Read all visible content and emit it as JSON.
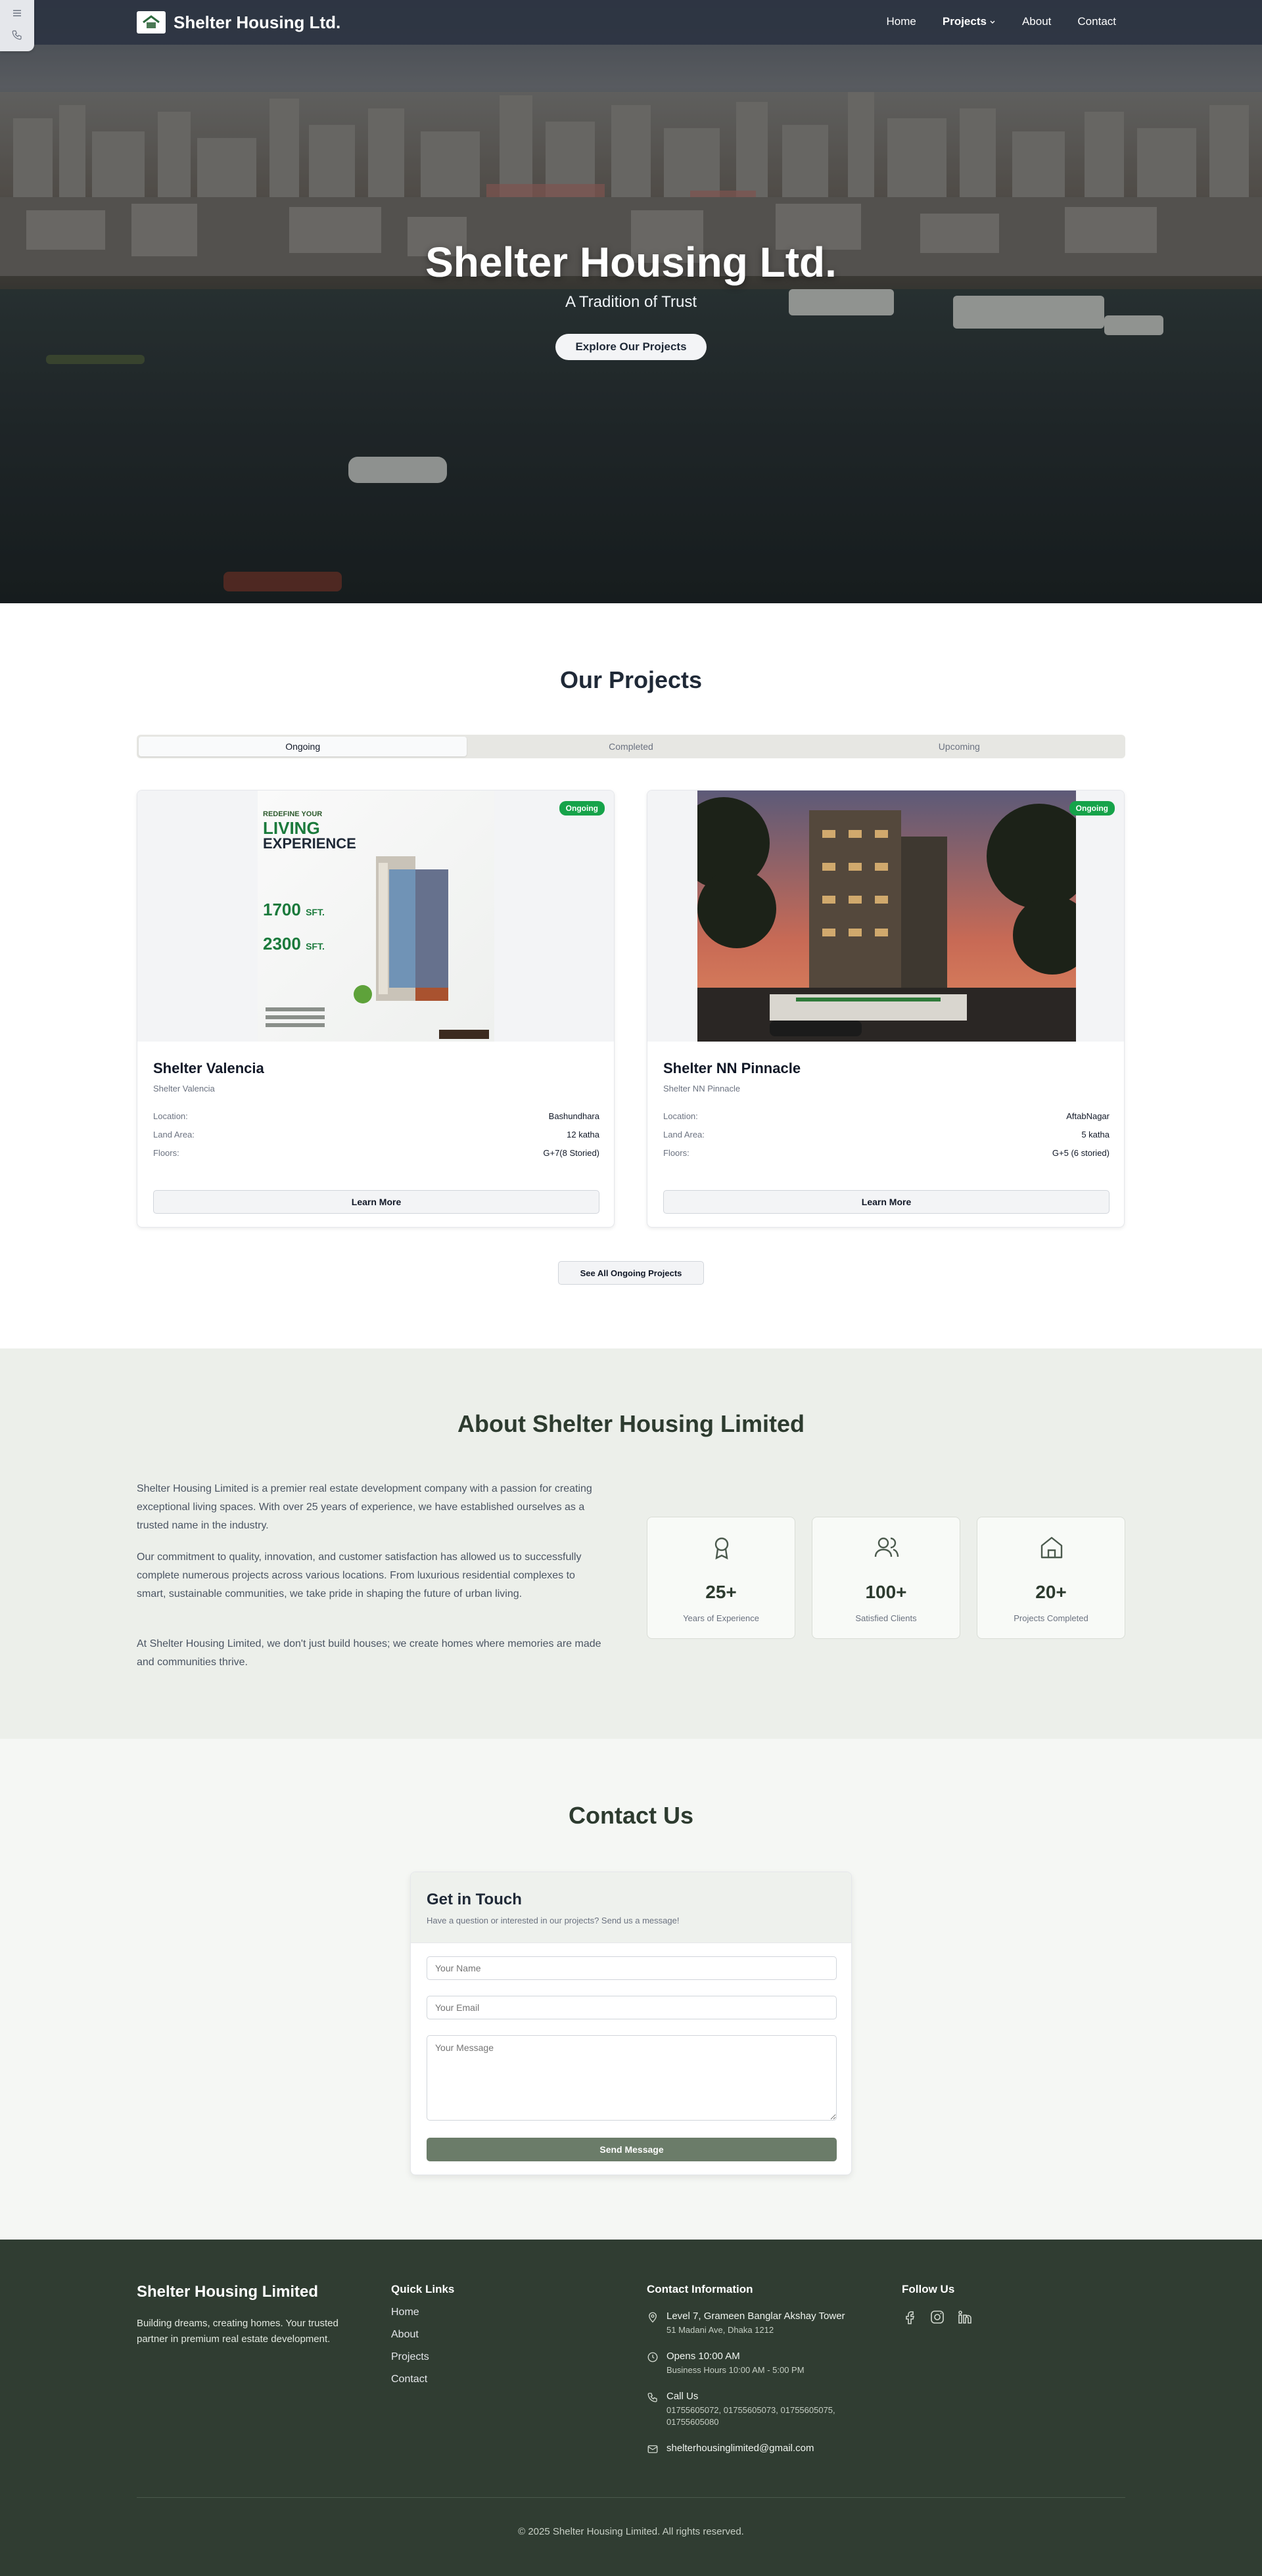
{
  "header": {
    "brand": "Shelter Housing Ltd.",
    "nav": [
      "Home",
      "Projects",
      "About",
      "Contact"
    ],
    "active_nav": "Projects"
  },
  "hero": {
    "title": "Shelter Housing Ltd.",
    "subtitle": "A Tradition of Trust",
    "cta": "Explore Our Projects"
  },
  "projects": {
    "title": "Our Projects",
    "tabs": [
      "Ongoing",
      "Completed",
      "Upcoming"
    ],
    "active_tab": "Ongoing",
    "cards": [
      {
        "badge": "Ongoing",
        "title": "Shelter Valencia",
        "subtitle": "Shelter Valencia",
        "location_label": "Location:",
        "location": "Bashundhara",
        "land_label": "Land Area:",
        "land": "12 katha",
        "floors_label": "Floors:",
        "floors": "G+7(8 Storied)",
        "button": "Learn More",
        "poster": {
          "line1": "REDEFINE YOUR",
          "line2": "LIVING",
          "line3": "EXPERIENCE",
          "size1": "1700",
          "size2": "2300",
          "unit": "SFT."
        }
      },
      {
        "badge": "Ongoing",
        "title": "Shelter NN Pinnacle",
        "subtitle": "Shelter NN Pinnacle",
        "location_label": "Location:",
        "location": "AftabNagar",
        "land_label": "Land Area:",
        "land": "5 katha",
        "floors_label": "Floors:",
        "floors": "G+5 (6 storied)",
        "button": "Learn More"
      }
    ],
    "see_all": "See All Ongoing Projects"
  },
  "about": {
    "title": "About Shelter Housing Limited",
    "paragraphs": [
      "Shelter Housing Limited is a premier real estate development company with a passion for creating exceptional living spaces. With over 25 years of experience, we have established ourselves as a trusted name in the industry.",
      "Our commitment to quality, innovation, and customer satisfaction has allowed us to successfully complete numerous projects across various locations. From luxurious residential complexes to smart, sustainable communities, we take pride in shaping the future of urban living.",
      "At Shelter Housing Limited, we don't just build houses; we create homes where memories are made and communities thrive."
    ],
    "stats": [
      {
        "icon": "award-icon",
        "value": "25+",
        "label": "Years of Experience"
      },
      {
        "icon": "users-icon",
        "value": "100+",
        "label": "Satisfied Clients"
      },
      {
        "icon": "home-icon",
        "value": "20+",
        "label": "Projects Completed"
      }
    ]
  },
  "contact": {
    "title": "Contact Us",
    "form_title": "Get in Touch",
    "form_subtitle": "Have a question or interested in our projects? Send us a message!",
    "name_placeholder": "Your Name",
    "email_placeholder": "Your Email",
    "message_placeholder": "Your Message",
    "send": "Send Message"
  },
  "footer": {
    "brand": "Shelter Housing Limited",
    "tagline": "Building dreams, creating homes. Your trusted partner in premium real estate development.",
    "quick_links_title": "Quick Links",
    "quick_links": [
      "Home",
      "About",
      "Projects",
      "Contact"
    ],
    "contact_title": "Contact Information",
    "address": "Level 7, Grameen Banglar Akshay Tower",
    "address_sub": "51 Madani Ave, Dhaka 1212",
    "hours": "Opens 10:00 AM",
    "hours_sub": "Business Hours 10:00 AM - 5:00 PM",
    "call": "Call Us",
    "phones": "01755605072, 01755605073, 01755605075, 01755605080",
    "email": "shelterhousinglimited@gmail.com",
    "follow_title": "Follow Us",
    "social": [
      "facebook-icon",
      "instagram-icon",
      "linkedin-icon"
    ],
    "copyright": "© 2025 Shelter Housing Limited. All rights reserved."
  },
  "colors": {
    "header_bg": "#2c3442",
    "badge_green": "#16a34a",
    "send_button": "#6b7c69",
    "footer_bg": "#303d32",
    "about_bg": "#ecefea"
  }
}
